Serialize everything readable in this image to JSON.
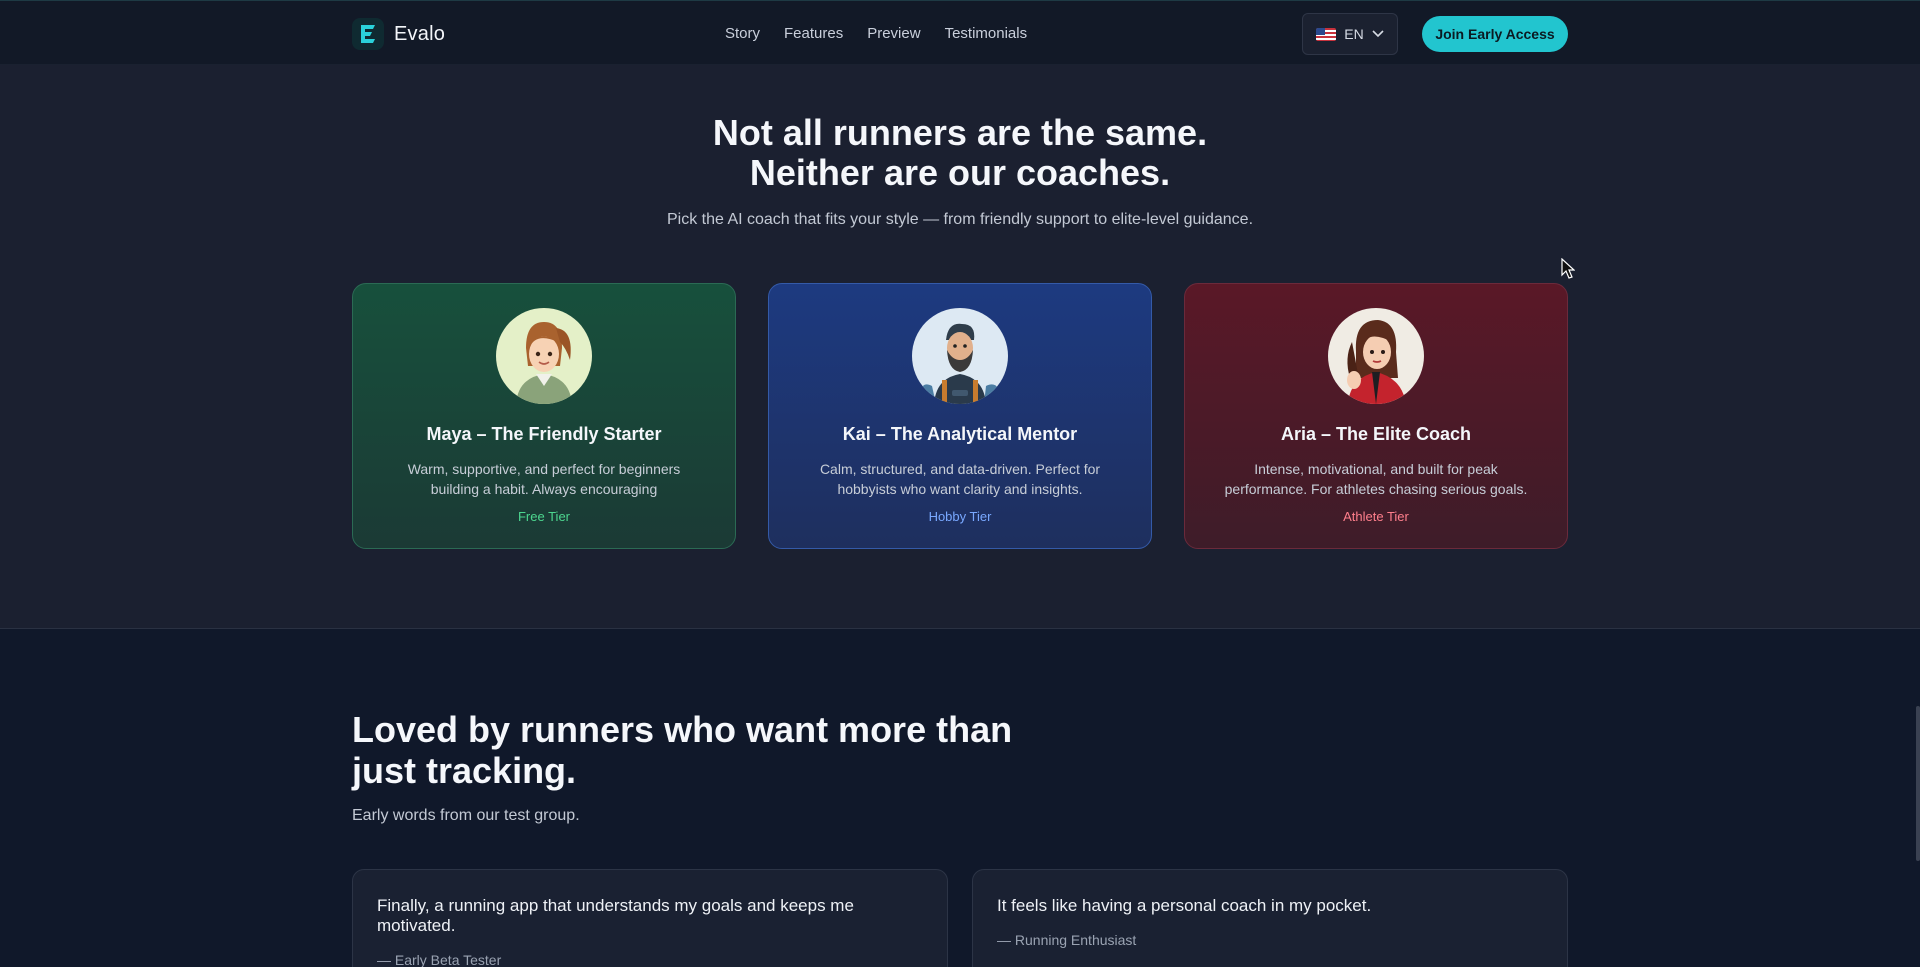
{
  "nav": {
    "brand": "Evalo",
    "links": [
      "Story",
      "Features",
      "Preview",
      "Testimonials"
    ],
    "language": "EN",
    "cta": "Join Early Access"
  },
  "coaches": {
    "title_line1": "Not all runners are the same.",
    "title_line2": "Neither are our coaches.",
    "subtitle": "Pick the AI coach that fits your style — from friendly support to elite-level guidance.",
    "cards": [
      {
        "name": "Maya – The Friendly Starter",
        "desc": "Warm, supportive, and perfect for beginners building a habit. Always encouraging",
        "tier": "Free Tier"
      },
      {
        "name": "Kai – The Analytical Mentor",
        "desc": "Calm, structured, and data-driven. Perfect for hobbyists who want clarity and insights.",
        "tier": "Hobby Tier"
      },
      {
        "name": "Aria – The Elite Coach",
        "desc": "Intense, motivational, and built for peak performance. For athletes chasing serious goals.",
        "tier": "Athlete Tier"
      }
    ]
  },
  "testimonials": {
    "title": "Loved by runners who want more than just tracking.",
    "subtitle": "Early words from our test group.",
    "quotes": [
      {
        "text": "Finally, a running app that understands my goals and keeps me motivated.",
        "author": "— Early Beta Tester"
      },
      {
        "text": "It feels like having a personal coach in my pocket.",
        "author": "— Running Enthusiast"
      }
    ]
  },
  "colors": {
    "accent": "#22c5cf",
    "free": "#4cd68f",
    "hobby": "#79a8ff",
    "athlete": "#ff7f8c"
  }
}
